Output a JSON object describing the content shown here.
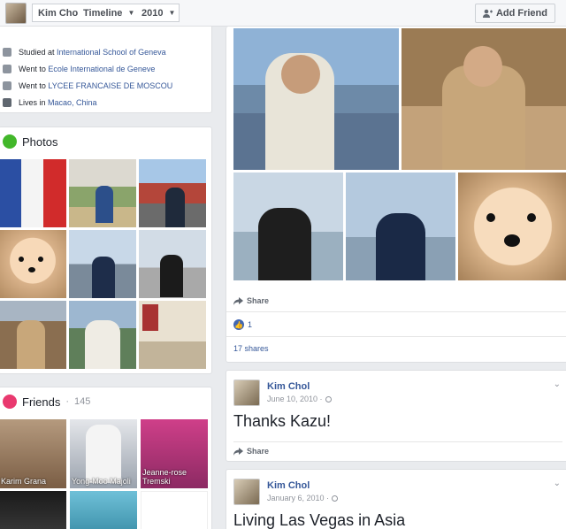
{
  "topbar": {
    "name": "Kim Chol",
    "timeline_label": "Timeline",
    "year_label": "2010",
    "add_friend_label": "Add Friend",
    "caret": "▼"
  },
  "intro": {
    "items": [
      {
        "prefix": "Studied at ",
        "link": "International School of Geneva",
        "icon": "graduation-cap-icon"
      },
      {
        "prefix": "Went to ",
        "link": "Ecole International de Geneve",
        "icon": "graduation-cap-icon"
      },
      {
        "prefix": "Went to ",
        "link": "LYCEE FRANCAISE DE MOSCOU",
        "icon": "graduation-cap-icon"
      },
      {
        "prefix": "Lives in ",
        "link": "Macao, China",
        "icon": "home-icon"
      }
    ]
  },
  "photos": {
    "title": "Photos",
    "icon_color": "#42b72a"
  },
  "friends": {
    "title": "Friends",
    "count": "145",
    "icon_color": "#e9396f",
    "list": [
      "Karim Grana",
      "Yong-Moo Majoli",
      "Jeanne-rose Tremski",
      "",
      "",
      ""
    ]
  },
  "photo_post": {
    "share_label": "Share",
    "like_count": "1",
    "shares_label": "17 shares"
  },
  "posts": [
    {
      "author": "Kim Chol",
      "date": "June 10, 2010 ·",
      "text": "Thanks Kazu!",
      "share_label": "Share"
    },
    {
      "author": "Kim Chol",
      "date": "January 6, 2010 ·",
      "text": "Living Las Vegas in Asia"
    }
  ],
  "colors": {
    "link": "#365899",
    "facebook_blue": "#4267b2"
  }
}
